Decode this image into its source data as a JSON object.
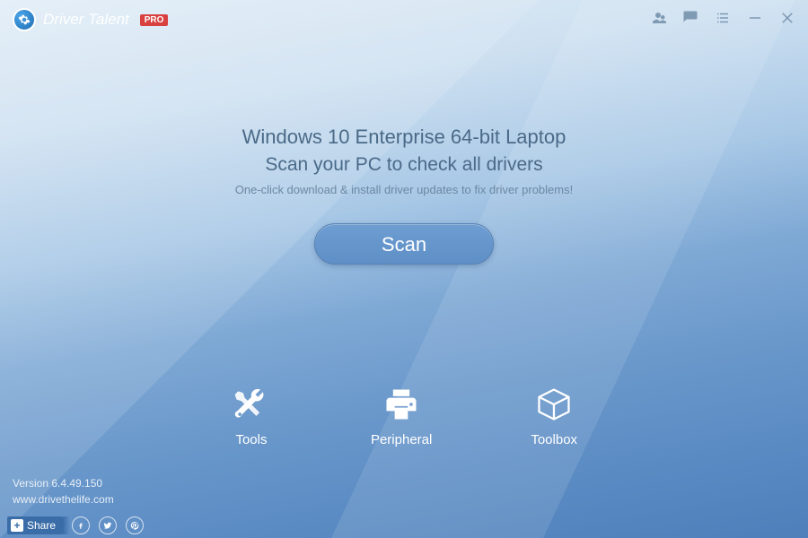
{
  "titlebar": {
    "app_name": "Driver Talent",
    "pro_badge": "PRO"
  },
  "center": {
    "system_info": "Windows 10 Enterprise 64-bit Laptop",
    "scan_message": "Scan your PC to check all drivers",
    "subtext": "One-click download & install driver updates to fix driver problems!",
    "scan_button": "Scan"
  },
  "nav": {
    "tools": "Tools",
    "peripheral": "Peripheral",
    "toolbox": "Toolbox"
  },
  "footer": {
    "version": "Version 6.4.49.150",
    "website": "www.drivethelife.com"
  },
  "share": {
    "label": "Share"
  }
}
